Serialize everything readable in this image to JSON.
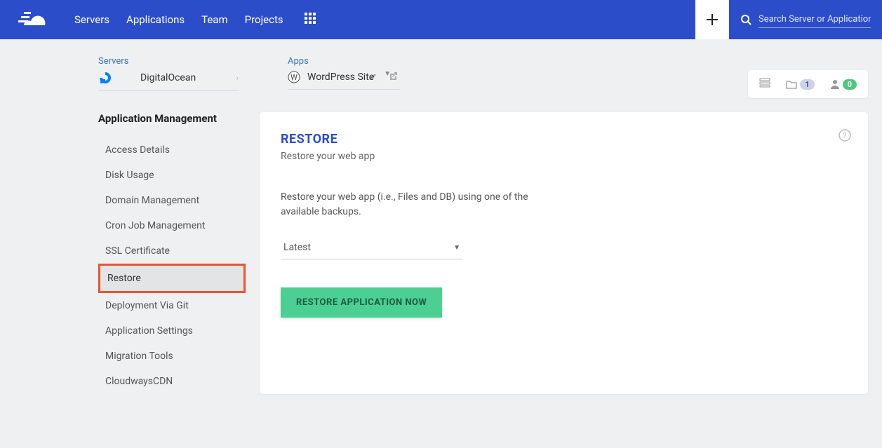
{
  "nav": {
    "items": [
      "Servers",
      "Applications",
      "Team",
      "Projects"
    ]
  },
  "search": {
    "placeholder": "Search Server or Application"
  },
  "breadcrumb": {
    "servers_label": "Servers",
    "server_name": "DigitalOcean",
    "apps_label": "Apps",
    "app_name": "WordPress Site"
  },
  "status": {
    "badge1": "1",
    "badge2": "0"
  },
  "sidebar": {
    "title": "Application Management",
    "items": [
      "Access Details",
      "Disk Usage",
      "Domain Management",
      "Cron Job Management",
      "SSL Certificate",
      "Restore",
      "Deployment Via Git",
      "Application Settings",
      "Migration Tools",
      "CloudwaysCDN"
    ],
    "active_index": 5
  },
  "card": {
    "title": "RESTORE",
    "subtitle": "Restore your web app",
    "description": "Restore your web app (i.e., Files and DB) using one of the available backups.",
    "select_value": "Latest",
    "button": "RESTORE APPLICATION NOW"
  }
}
